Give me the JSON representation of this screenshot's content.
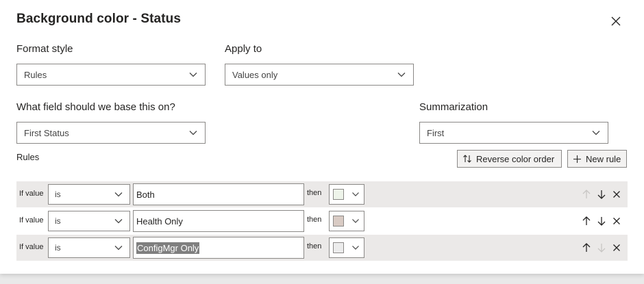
{
  "dialog": {
    "title": "Background color - Status"
  },
  "format_style": {
    "label": "Format style",
    "value": "Rules"
  },
  "apply_to": {
    "label": "Apply to",
    "value": "Values only"
  },
  "base_field": {
    "label": "What field should we base this on?",
    "value": "First Status"
  },
  "summarization": {
    "label": "Summarization",
    "value": "First"
  },
  "rules": {
    "label": "Rules",
    "reverse_label": "Reverse color order",
    "new_rule_label": "New rule",
    "items": [
      {
        "if_label": "If value",
        "operator": "is",
        "value": "Both",
        "then_label": "then",
        "color": "#eef4ea",
        "up_enabled": false,
        "down_enabled": true
      },
      {
        "if_label": "If value",
        "operator": "is",
        "value": "Health Only",
        "then_label": "then",
        "color": "#d9cbc4",
        "up_enabled": true,
        "down_enabled": true
      },
      {
        "if_label": "If value",
        "operator": "is",
        "value": "ConfigMgr Only",
        "then_label": "then",
        "color": "#ececec",
        "up_enabled": true,
        "down_enabled": false
      }
    ]
  },
  "icons": [
    "close-icon",
    "chevron-down-icon",
    "sort-icon",
    "plus-icon",
    "arrow-up-icon",
    "arrow-down-icon",
    "delete-icon"
  ]
}
